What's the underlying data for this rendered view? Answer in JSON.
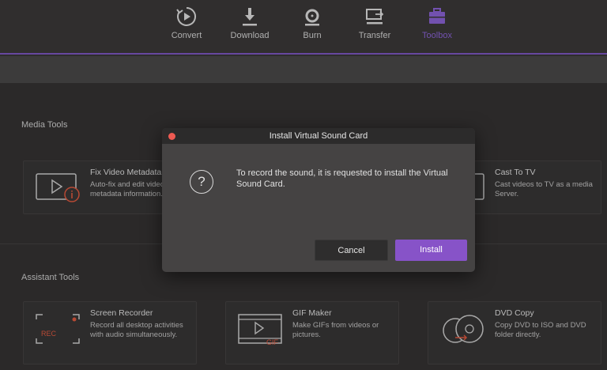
{
  "nav": {
    "items": [
      {
        "label": "Convert",
        "icon": "convert-icon"
      },
      {
        "label": "Download",
        "icon": "download-icon"
      },
      {
        "label": "Burn",
        "icon": "burn-icon"
      },
      {
        "label": "Transfer",
        "icon": "transfer-icon"
      },
      {
        "label": "Toolbox",
        "icon": "toolbox-icon",
        "active": true
      }
    ],
    "accent_color": "#8c63d6"
  },
  "media_tools": {
    "title": "Media Tools",
    "cards": [
      {
        "title": "Fix Video Metadata",
        "desc": "Auto-fix and edit video metadata information.",
        "icon": "video-info-icon"
      },
      {
        "title": "Cast To TV",
        "desc": "Cast videos to TV as a media Server.",
        "icon": "tv-icon"
      }
    ]
  },
  "assistant_tools": {
    "title": "Assistant Tools",
    "cards": [
      {
        "title": "Screen Recorder",
        "desc": "Record all desktop activities with audio simultaneously.",
        "icon": "screen-recorder-icon",
        "badge": "REC"
      },
      {
        "title": "GIF Maker",
        "desc": "Make GIFs from videos or pictures.",
        "icon": "gif-maker-icon",
        "badge": "GIF"
      },
      {
        "title": "DVD Copy",
        "desc": "Copy DVD to ISO and DVD folder directly.",
        "icon": "dvd-copy-icon"
      }
    ]
  },
  "dialog": {
    "title": "Install Virtual Sound Card",
    "icon": "question-icon",
    "icon_glyph": "?",
    "message": "To record the sound, it is requested to install the Virtual Sound Card.",
    "cancel_label": "Cancel",
    "install_label": "Install",
    "install_color": "#8753c8",
    "close_color": "#ee5a52"
  }
}
